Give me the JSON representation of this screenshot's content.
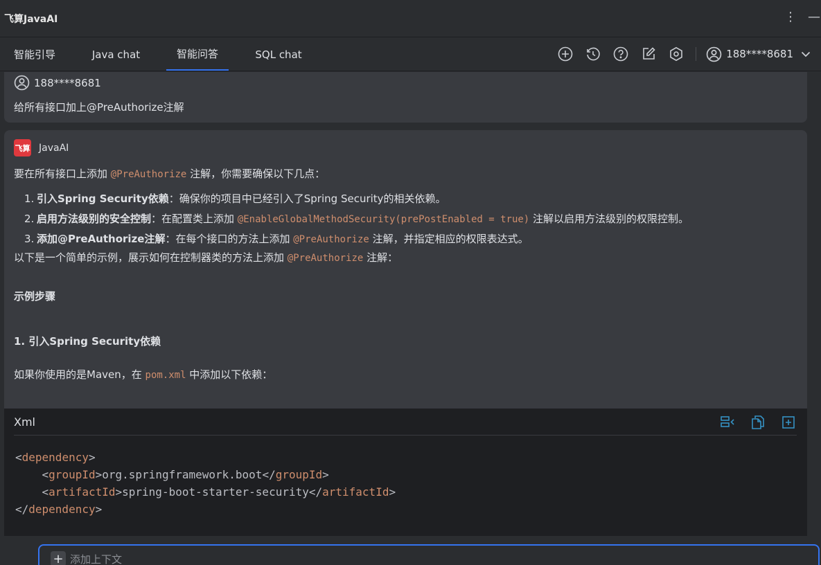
{
  "window": {
    "title": "飞算JavaAI"
  },
  "tabs": [
    {
      "label": "智能引导"
    },
    {
      "label": "Java chat"
    },
    {
      "label": "智能问答"
    },
    {
      "label": "SQL chat"
    }
  ],
  "active_tab": "智能问答",
  "toolbar": {
    "icons": [
      "add-icon",
      "history-icon",
      "help-icon",
      "edit-icon",
      "settings-icon"
    ],
    "user": "188****8681"
  },
  "user_message": {
    "user": "188****8681",
    "text": "给所有接口加上@PreAuthorize注解"
  },
  "ai_message": {
    "name": "JavaAI",
    "logo_text": "飞算",
    "intro_pre": "要在所有接口上添加 ",
    "intro_code": "@PreAuthorize",
    "intro_post": " 注解，你需要确保以下几点：",
    "list": [
      {
        "num": "1.",
        "bold": "引入Spring Security依赖",
        "text": "：确保你的项目中已经引入了Spring Security的相关依赖。",
        "code": "",
        "after": ""
      },
      {
        "num": "2.",
        "bold": "启用方法级别的安全控制",
        "text": "：在配置类上添加 ",
        "code": "@EnableGlobalMethodSecurity(prePostEnabled = true)",
        "after": " 注解以启用方法级别的权限控制。"
      },
      {
        "num": "3.",
        "bold": "添加@PreAuthorize注解",
        "text": "：在每个接口的方法上添加 ",
        "code": "@PreAuthorize",
        "after": " 注解，并指定相应的权限表达式。"
      }
    ],
    "example_pre": "以下是一个简单的示例，展示如何在控制器类的方法上添加 ",
    "example_code": "@PreAuthorize",
    "example_post": " 注解：",
    "heading1": "示例步骤",
    "heading2": "1. 引入Spring Security依赖",
    "maven_pre": "如果你使用的是Maven，在 ",
    "maven_code": "pom.xml",
    "maven_post": " 中添加以下依赖：",
    "code_block": {
      "language": "Xml",
      "lines": [
        {
          "indent": "",
          "open": "dependency",
          "text": "",
          "close": ""
        },
        {
          "indent": "    ",
          "open": "groupId",
          "text": "org.springframework.boot",
          "close": "groupId"
        },
        {
          "indent": "    ",
          "open": "artifactId",
          "text": "spring-boot-starter-security",
          "close": "artifactId"
        },
        {
          "indent": "",
          "open": "",
          "text": "",
          "close": "dependency"
        }
      ]
    }
  },
  "input": {
    "add_context": "添加上下文"
  },
  "colors": {
    "accent": "#3574f0",
    "code_keyword": "#cf8e6d",
    "logo": "#e0393e"
  }
}
